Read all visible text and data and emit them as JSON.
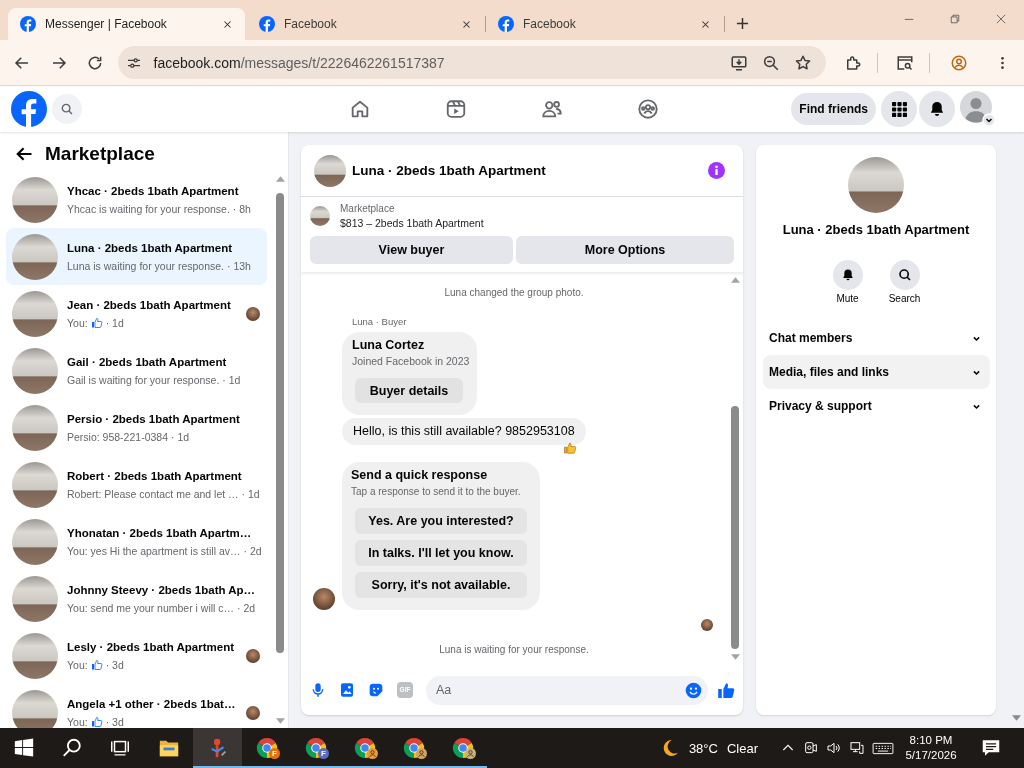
{
  "browser": {
    "tabs": [
      {
        "title": "Messenger | Facebook",
        "selected": true
      },
      {
        "title": "Facebook",
        "selected": false
      },
      {
        "title": "Facebook",
        "selected": false
      }
    ],
    "address": {
      "host": "facebook.com",
      "path": "/messages/t/2226462261517387"
    }
  },
  "facebook_bar": {
    "find_friends": "Find friends"
  },
  "sidebar": {
    "title": "Marketplace",
    "conversations": [
      {
        "title": "Yhcac · 2beds 1bath Apartment",
        "kind": "text",
        "preview": "Yhcac is waiting for your response.",
        "time": "· 8h",
        "selected": false,
        "seen": false
      },
      {
        "title": "Luna · 2beds 1bath Apartment",
        "kind": "text",
        "preview": "Luna is waiting for your response.",
        "time": "· 13h",
        "selected": true,
        "seen": false
      },
      {
        "title": "Jean · 2beds 1bath Apartment",
        "kind": "like",
        "preview": "You:",
        "time": "· 1d",
        "selected": false,
        "seen": true
      },
      {
        "title": "Gail · 2beds 1bath Apartment",
        "kind": "text",
        "preview": "Gail is waiting for your response.",
        "time": "· 1d",
        "selected": false,
        "seen": false
      },
      {
        "title": "Persio · 2beds 1bath Apartment",
        "kind": "text",
        "preview": "Persio: 958-221-0384",
        "time": "· 1d",
        "selected": false,
        "seen": false
      },
      {
        "title": "Robert · 2beds 1bath Apartment",
        "kind": "text",
        "preview": "Robert: Please contact me and let …",
        "time": "· 1d",
        "selected": false,
        "seen": false
      },
      {
        "title": "Yhonatan · 2beds 1bath Apartm…",
        "kind": "text",
        "preview": "You: yes Hi the apartment is still av…",
        "time": "· 2d",
        "selected": false,
        "seen": false
      },
      {
        "title": "Johnny Steevy · 2beds 1bath Ap…",
        "kind": "text",
        "preview": "You: send me your number i will c…",
        "time": "· 2d",
        "selected": false,
        "seen": false
      },
      {
        "title": "Lesly · 2beds 1bath Apartment",
        "kind": "like",
        "preview": "You:",
        "time": "· 3d",
        "selected": false,
        "seen": true
      },
      {
        "title": "Angela +1 other · 2beds 1bat…",
        "kind": "like",
        "preview": "You:",
        "time": "· 3d",
        "selected": false,
        "seen": true
      }
    ]
  },
  "chat": {
    "title": "Luna · 2beds 1bath Apartment",
    "listing": {
      "label": "Marketplace",
      "summary": "$813 – 2beds 1bath Apartment"
    },
    "actions": [
      "View buyer",
      "More Options"
    ],
    "timeline": [
      {
        "kind": "event",
        "text": "Luna changed the group photo."
      },
      {
        "kind": "sender",
        "text": "Luna · Buyer"
      },
      {
        "kind": "buyer_card",
        "name": "Luna Cortez",
        "subtitle": "Joined Facebook in 2023",
        "button": "Buyer details"
      },
      {
        "kind": "message",
        "text": "Hello, is this still available? 9852953108",
        "reacted": true
      },
      {
        "kind": "quick_replies",
        "title": "Send a quick response",
        "subtitle": "Tap a response to send it to the buyer.",
        "options": [
          "Yes. Are you interested?",
          "In talks. I'll let you know.",
          "Sorry, it's not available."
        ],
        "show_avatar": true
      },
      {
        "kind": "seen"
      },
      {
        "kind": "event",
        "text": "Luna is waiting for your response."
      }
    ],
    "composer": {
      "gif": "GIF",
      "placeholder": "Aa"
    }
  },
  "details": {
    "title": "Luna · 2beds 1bath Apartment",
    "actions": [
      {
        "kind": "mute",
        "label": "Mute"
      },
      {
        "kind": "search",
        "label": "Search"
      }
    ],
    "sections": [
      {
        "label": "Chat members",
        "highlighted": false
      },
      {
        "label": "Media, files and links",
        "highlighted": true
      },
      {
        "label": "Privacy & support",
        "highlighted": false
      }
    ]
  },
  "taskbar": {
    "apps": [
      {
        "kind": "explorer",
        "running": false,
        "active": false
      },
      {
        "kind": "tool",
        "running": true,
        "active": true
      },
      {
        "kind": "chrome",
        "running": true,
        "active": false,
        "badge": {
          "kind": "letter",
          "text": "F",
          "color": "#e8710a"
        }
      },
      {
        "kind": "chrome",
        "running": true,
        "active": false,
        "badge": {
          "kind": "letter",
          "text": "F",
          "color": "#5c6bc0"
        }
      },
      {
        "kind": "chrome",
        "running": true,
        "active": false,
        "badge": {
          "kind": "person",
          "color": "#e59a3c"
        }
      },
      {
        "kind": "chrome",
        "running": true,
        "active": false,
        "badge": {
          "kind": "person",
          "color": "#d4a262"
        }
      },
      {
        "kind": "chrome",
        "running": true,
        "active": false,
        "badge": {
          "kind": "person",
          "color": "#c6b27c"
        }
      }
    ],
    "weather": {
      "temperature": "38°C",
      "condition": "Clear"
    },
    "time": "8:10 PM",
    "date": "5/17/2026"
  }
}
